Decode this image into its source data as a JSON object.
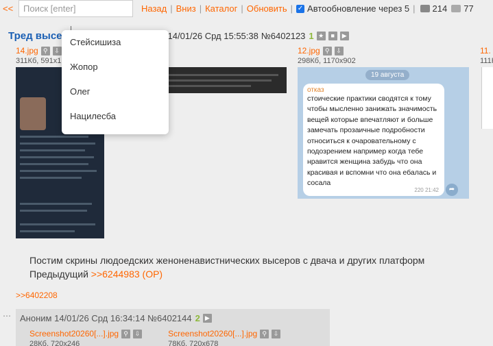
{
  "nav": {
    "back_arrows": "<<",
    "search_placeholder": "Поиск [enter]",
    "links": [
      "Назад",
      "Вниз",
      "Каталог",
      "Обновить"
    ],
    "auto_update": "Автообновление через 5",
    "posts_count": "214",
    "images_count": "77"
  },
  "thread": {
    "title": "Тред высе",
    "datetime": "14/01/26 Срд 15:55:38",
    "number": "№6402123",
    "reply_count": "1"
  },
  "files": [
    {
      "name": "14.jpg",
      "info": "311Кб, 591x1"
    },
    {
      "name": "12.jpg",
      "info": "298Кб, 1170x902"
    },
    {
      "name": "11.",
      "info": "111К"
    }
  ],
  "telegram": {
    "date": "19 августа",
    "sender": "отказ",
    "text": "стоические практики сводятся к тому чтобы мысленно занижать значимость вещей которые впечатляют и больше замечать прозаичные подробности относиться к очаровательному с подозрением например когда тебе нравится женщина забудь что она красивая и вспомни что она ебалась и сосала",
    "time": "220 21:42"
  },
  "post": {
    "line1": "Постим скрины людоедских женоненавистнических высеров с двача и других платформ",
    "prev_label": "Предыдущий",
    "prev_link": ">>6244983 (OP)"
  },
  "reply_ref": ">>6402208",
  "reply": {
    "author": "Аноним",
    "datetime": "14/01/26 Срд 16:34:14",
    "number": "№6402144",
    "count": "2",
    "files": [
      {
        "name": "Screenshot20260[...].jpg",
        "info": "28Кб, 720x246"
      },
      {
        "name": "Screenshot20260[...].jpg",
        "info": "78Кб, 720x678"
      }
    ]
  },
  "dropdown": {
    "items": [
      "Стейсишиза",
      "Жопор",
      "Олег",
      "Нацилесба"
    ]
  }
}
